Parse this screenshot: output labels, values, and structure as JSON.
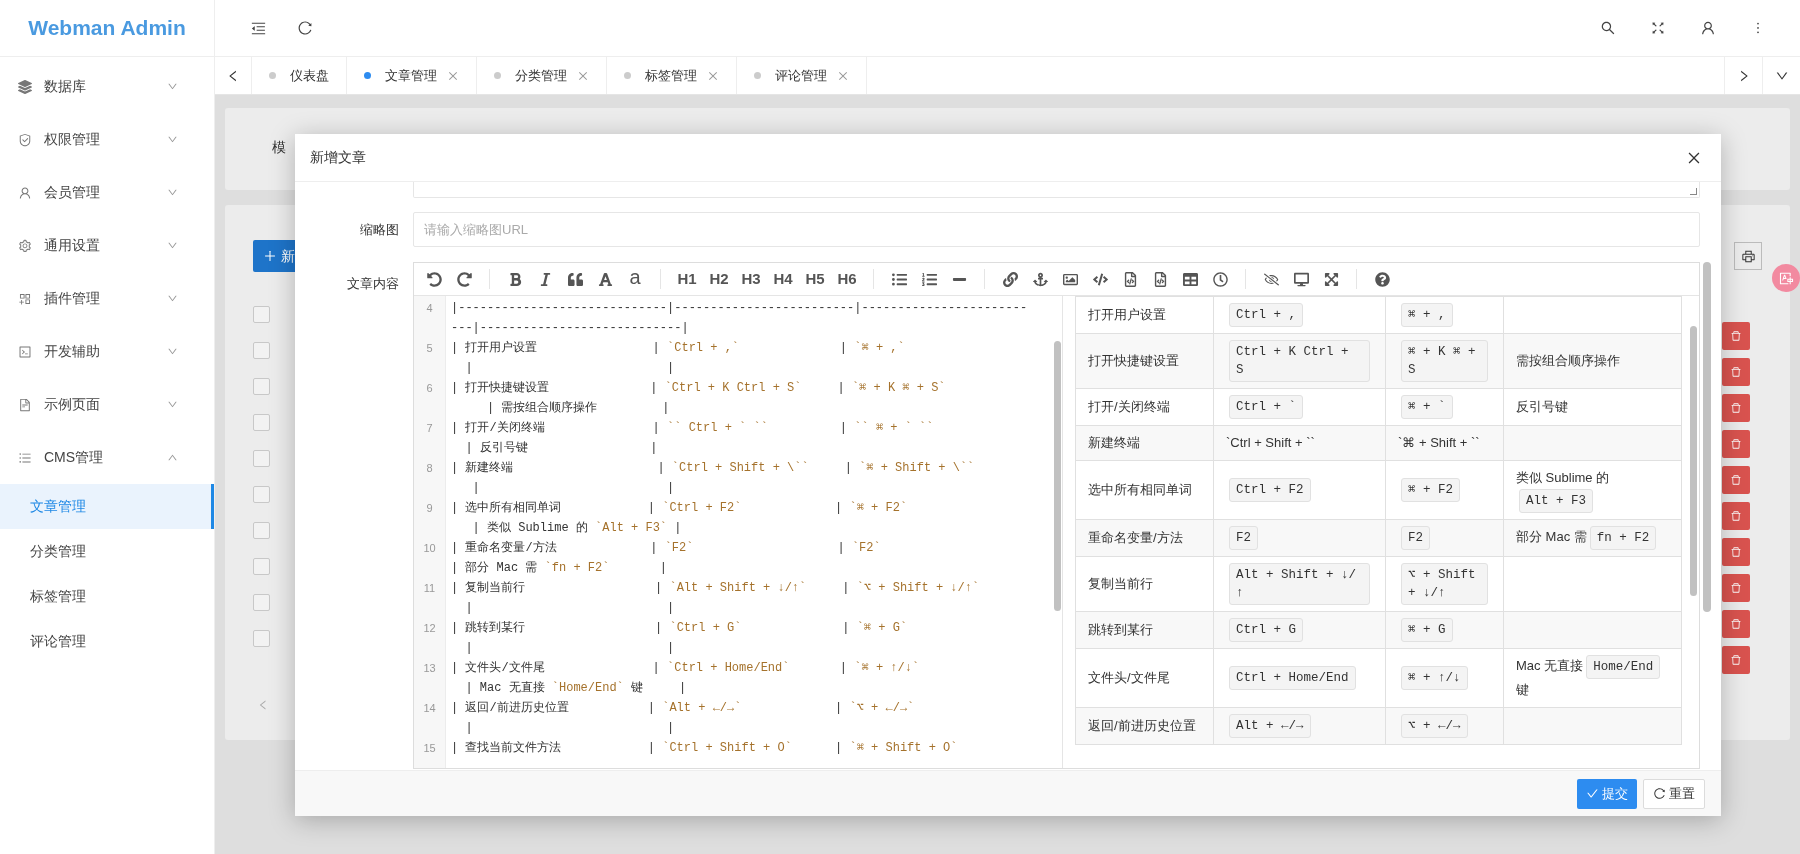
{
  "sidebar": {
    "logo": "Webman Admin",
    "items": [
      {
        "label": "数据库",
        "expanded": false
      },
      {
        "label": "权限管理",
        "expanded": false
      },
      {
        "label": "会员管理",
        "expanded": false
      },
      {
        "label": "通用设置",
        "expanded": false
      },
      {
        "label": "插件管理",
        "expanded": false
      },
      {
        "label": "开发辅助",
        "expanded": false
      },
      {
        "label": "示例页面",
        "expanded": false
      },
      {
        "label": "CMS管理",
        "expanded": true,
        "children": [
          {
            "label": "文章管理",
            "selected": true
          },
          {
            "label": "分类管理",
            "selected": false
          },
          {
            "label": "标签管理",
            "selected": false
          },
          {
            "label": "评论管理",
            "selected": false
          }
        ]
      }
    ]
  },
  "tabs": [
    {
      "label": "仪表盘",
      "selected": false,
      "closable": false
    },
    {
      "label": "文章管理",
      "selected": true,
      "closable": true
    },
    {
      "label": "分类管理",
      "selected": false,
      "closable": true
    },
    {
      "label": "标签管理",
      "selected": false,
      "closable": true
    },
    {
      "label": "评论管理",
      "selected": false,
      "closable": true
    }
  ],
  "background": {
    "filter_label": "模",
    "add_button": "新",
    "rows": [
      {
        "checked": false
      },
      {
        "checked": false
      },
      {
        "checked": false
      },
      {
        "checked": false
      },
      {
        "checked": false
      },
      {
        "checked": false
      },
      {
        "checked": false
      },
      {
        "checked": false
      },
      {
        "checked": false
      },
      {
        "checked": false
      }
    ]
  },
  "modal": {
    "title": "新增文章",
    "fields": [
      {
        "label": "缩略图",
        "placeholder": "请输入缩略图URL"
      }
    ],
    "content_label": "文章内容",
    "toolbar": {
      "headings": [
        "H1",
        "H2",
        "H3",
        "H4",
        "H5",
        "H6"
      ],
      "lowercase": "a"
    },
    "code_lines": [
      {
        "number": "4",
        "rows": [
          {
            "parts": [
              {
                "kind": "text",
                "text": "|-----------------------------|-------------------------|-----------------------"
              }
            ]
          },
          {
            "parts": [
              {
                "kind": "text",
                "text": "---|----------------------------|"
              }
            ]
          }
        ]
      },
      {
        "number": "5",
        "rows": [
          {
            "parts": [
              {
                "kind": "text",
                "text": "| 打开用户设置                | "
              },
              {
                "kind": "code",
                "text": "`Ctrl + ,`"
              },
              {
                "kind": "text",
                "text": "              | "
              },
              {
                "kind": "code",
                "text": "`⌘ + ,`"
              }
            ]
          },
          {
            "parts": [
              {
                "kind": "text",
                "text": "  |                           |"
              }
            ]
          }
        ]
      },
      {
        "number": "6",
        "rows": [
          {
            "parts": [
              {
                "kind": "text",
                "text": "| 打开快捷键设置              | "
              },
              {
                "kind": "code",
                "text": "`Ctrl + K Ctrl + S`"
              },
              {
                "kind": "text",
                "text": "     | "
              },
              {
                "kind": "code",
                "text": "`⌘ + K ⌘ + S`"
              }
            ]
          },
          {
            "parts": [
              {
                "kind": "text",
                "text": "     | 需按组合顺序操作         |"
              }
            ]
          }
        ]
      },
      {
        "number": "7",
        "rows": [
          {
            "parts": [
              {
                "kind": "text",
                "text": "| 打开/关闭终端               | "
              },
              {
                "kind": "code",
                "text": "`` Ctrl + ` ``"
              },
              {
                "kind": "text",
                "text": "          | "
              },
              {
                "kind": "code",
                "text": "`` ⌘ + ` ``"
              }
            ]
          },
          {
            "parts": [
              {
                "kind": "text",
                "text": "  | 反引号键                 |"
              }
            ]
          }
        ]
      },
      {
        "number": "8",
        "rows": [
          {
            "parts": [
              {
                "kind": "text",
                "text": "| 新建终端                    | "
              },
              {
                "kind": "code",
                "text": "`Ctrl + Shift + \\``"
              },
              {
                "kind": "text",
                "text": "     | "
              },
              {
                "kind": "code",
                "text": "`⌘ + Shift + \\``"
              }
            ]
          },
          {
            "parts": [
              {
                "kind": "text",
                "text": "   |                          |"
              }
            ]
          }
        ]
      },
      {
        "number": "9",
        "rows": [
          {
            "parts": [
              {
                "kind": "text",
                "text": "| 选中所有相同单词            | "
              },
              {
                "kind": "code",
                "text": "`Ctrl + F2`"
              },
              {
                "kind": "text",
                "text": "             | "
              },
              {
                "kind": "code",
                "text": "`⌘ + F2`"
              }
            ]
          },
          {
            "parts": [
              {
                "kind": "text",
                "text": "   | 类似 Sublime 的 "
              },
              {
                "kind": "code",
                "text": "`Alt + F3`"
              },
              {
                "kind": "text",
                "text": " |"
              }
            ]
          }
        ]
      },
      {
        "number": "10",
        "rows": [
          {
            "parts": [
              {
                "kind": "text",
                "text": "| 重命名变量/方法             | "
              },
              {
                "kind": "code",
                "text": "`F2`"
              },
              {
                "kind": "text",
                "text": "                    | "
              },
              {
                "kind": "code",
                "text": "`F2`"
              }
            ]
          },
          {
            "parts": [
              {
                "kind": "text",
                "text": "| 部分 Mac 需 "
              },
              {
                "kind": "code",
                "text": "`fn + F2`"
              },
              {
                "kind": "text",
                "text": "       |"
              }
            ]
          }
        ]
      },
      {
        "number": "11",
        "rows": [
          {
            "parts": [
              {
                "kind": "text",
                "text": "| 复制当前行                  | "
              },
              {
                "kind": "code",
                "text": "`Alt + Shift + ↓/↑`"
              },
              {
                "kind": "text",
                "text": "     | "
              },
              {
                "kind": "code",
                "text": "`⌥ + Shift + ↓/↑`"
              }
            ]
          },
          {
            "parts": [
              {
                "kind": "text",
                "text": "  |                           |"
              }
            ]
          }
        ]
      },
      {
        "number": "12",
        "rows": [
          {
            "parts": [
              {
                "kind": "text",
                "text": "| 跳转到某行                  | "
              },
              {
                "kind": "code",
                "text": "`Ctrl + G`"
              },
              {
                "kind": "text",
                "text": "              | "
              },
              {
                "kind": "code",
                "text": "`⌘ + G`"
              }
            ]
          },
          {
            "parts": [
              {
                "kind": "text",
                "text": "  |                           |"
              }
            ]
          }
        ]
      },
      {
        "number": "13",
        "rows": [
          {
            "parts": [
              {
                "kind": "text",
                "text": "| 文件头/文件尾               | "
              },
              {
                "kind": "code",
                "text": "`Ctrl + Home/End`"
              },
              {
                "kind": "text",
                "text": "       | "
              },
              {
                "kind": "code",
                "text": "`⌘ + ↑/↓`"
              }
            ]
          },
          {
            "parts": [
              {
                "kind": "text",
                "text": "  | Mac 无直接 "
              },
              {
                "kind": "code",
                "text": "`Home/End`"
              },
              {
                "kind": "text",
                "text": " 键     |"
              }
            ]
          }
        ]
      },
      {
        "number": "14",
        "rows": [
          {
            "parts": [
              {
                "kind": "text",
                "text": "| 返回/前进历史位置           | "
              },
              {
                "kind": "code",
                "text": "`Alt + ←/→`"
              },
              {
                "kind": "text",
                "text": "             | "
              },
              {
                "kind": "code",
                "text": "`⌥ + ←/→`"
              }
            ]
          },
          {
            "parts": [
              {
                "kind": "text",
                "text": "  |                           |"
              }
            ]
          }
        ]
      },
      {
        "number": "15",
        "rows": [
          {
            "parts": [
              {
                "kind": "text",
                "text": "| 查找当前文件方法            | "
              },
              {
                "kind": "code",
                "text": "`Ctrl + Shift + O`"
              },
              {
                "kind": "text",
                "text": "      | "
              },
              {
                "kind": "code",
                "text": "`⌘ + Shift + O`"
              }
            ]
          }
        ]
      }
    ],
    "preview_rows": [
      {
        "action": "打开用户设置",
        "windows": [
          {
            "kind": "kbd",
            "text": "Ctrl + ,"
          }
        ],
        "mac": [
          {
            "kind": "kbd",
            "text": "⌘ + ,"
          }
        ]
      },
      {
        "action": "打开快捷键设置",
        "windows": [
          {
            "kind": "kbd",
            "text": "Ctrl + K Ctrl + S"
          }
        ],
        "mac": [
          {
            "kind": "kbd",
            "text": "⌘ + K ⌘ + S"
          }
        ],
        "note": [
          {
            "kind": "text",
            "text": "需按组合顺序操作"
          }
        ]
      },
      {
        "action": "打开/关闭终端",
        "windows": [
          {
            "kind": "kbd",
            "text": "Ctrl + `"
          }
        ],
        "mac": [
          {
            "kind": "kbd",
            "text": "⌘ + `"
          }
        ],
        "note": [
          {
            "kind": "text",
            "text": "反引号键"
          }
        ]
      },
      {
        "action": "新建终端",
        "windows": [
          {
            "kind": "text",
            "text": "`Ctrl + Shift + ``"
          }
        ],
        "mac": [
          {
            "kind": "text",
            "text": "`⌘ + Shift + ``"
          }
        ]
      },
      {
        "action": "选中所有相同单词",
        "windows": [
          {
            "kind": "kbd",
            "text": "Ctrl + F2"
          }
        ],
        "mac": [
          {
            "kind": "kbd",
            "text": "⌘ + F2"
          }
        ],
        "note": [
          {
            "kind": "text",
            "text": "类似 Sublime 的"
          },
          {
            "kind": "kbd",
            "text": "Alt + F3"
          }
        ]
      },
      {
        "action": "重命名变量/方法",
        "windows": [
          {
            "kind": "kbd",
            "text": "F2"
          }
        ],
        "mac": [
          {
            "kind": "kbd",
            "text": "F2"
          }
        ],
        "note": [
          {
            "kind": "text",
            "text": "部分 Mac 需"
          },
          {
            "kind": "kbd",
            "text": "fn + F2"
          }
        ]
      },
      {
        "action": "复制当前行",
        "windows": [
          {
            "kind": "kbd",
            "text": "Alt + Shift + ↓/↑"
          }
        ],
        "mac": [
          {
            "kind": "kbd",
            "text": "⌥ + Shift + ↓/↑"
          }
        ]
      },
      {
        "action": "跳转到某行",
        "windows": [
          {
            "kind": "kbd",
            "text": "Ctrl + G"
          }
        ],
        "mac": [
          {
            "kind": "kbd",
            "text": "⌘ + G"
          }
        ]
      },
      {
        "action": "文件头/文件尾",
        "windows": [
          {
            "kind": "kbd",
            "text": "Ctrl + Home/End"
          }
        ],
        "mac": [
          {
            "kind": "kbd",
            "text": "⌘ + ↑/↓"
          }
        ],
        "note": [
          {
            "kind": "text",
            "text": "Mac 无直接"
          },
          {
            "kind": "kbd",
            "text": "Home/End"
          },
          {
            "kind": "text",
            "text": "键"
          }
        ]
      },
      {
        "action": "返回/前进历史位置",
        "windows": [
          {
            "kind": "kbd",
            "text": "Alt + ←/→"
          }
        ],
        "mac": [
          {
            "kind": "kbd",
            "text": "⌥ + ←/→"
          }
        ]
      }
    ],
    "buttons": [
      {
        "label": "提交",
        "kind": "primary"
      },
      {
        "label": "重置",
        "kind": "default"
      }
    ]
  }
}
